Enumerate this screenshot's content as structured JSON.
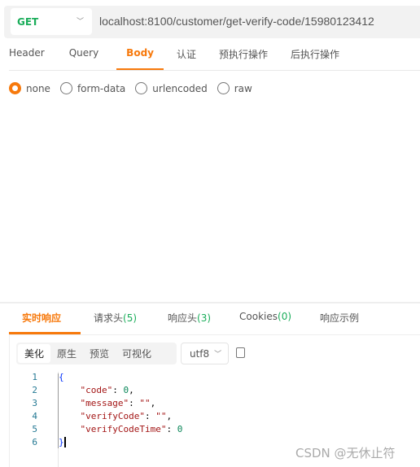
{
  "request": {
    "method": "GET",
    "url": "localhost:8100/customer/get-verify-code/15980123412"
  },
  "tabs": [
    {
      "label": "Header"
    },
    {
      "label": "Query"
    },
    {
      "label": "Body",
      "active": true
    },
    {
      "label": "认证"
    },
    {
      "label": "预执行操作"
    },
    {
      "label": "后执行操作"
    }
  ],
  "body_types": [
    {
      "label": "none",
      "selected": true
    },
    {
      "label": "form-data"
    },
    {
      "label": "urlencoded"
    },
    {
      "label": "raw"
    }
  ],
  "response_tabs": [
    {
      "label": "实时响应",
      "count": ""
    },
    {
      "label": "请求头",
      "count": "(5)"
    },
    {
      "label": "响应头",
      "count": "(3)"
    },
    {
      "label": "Cookies",
      "count": "(0)"
    },
    {
      "label": "响应示例",
      "count": ""
    }
  ],
  "view_modes": [
    "美化",
    "原生",
    "预览",
    "可视化"
  ],
  "encoding": "utf8",
  "code_lines": [
    "{",
    "    \"code\": 0,",
    "    \"message\": \"\",",
    "    \"verifyCode\": \"\",",
    "    \"verifyCodeTime\": 0",
    "}"
  ],
  "watermark": "CSDN @无休止符",
  "colors": {
    "accent": "#f7790c",
    "method": "#1aad5a",
    "count": "#1aad5a"
  }
}
